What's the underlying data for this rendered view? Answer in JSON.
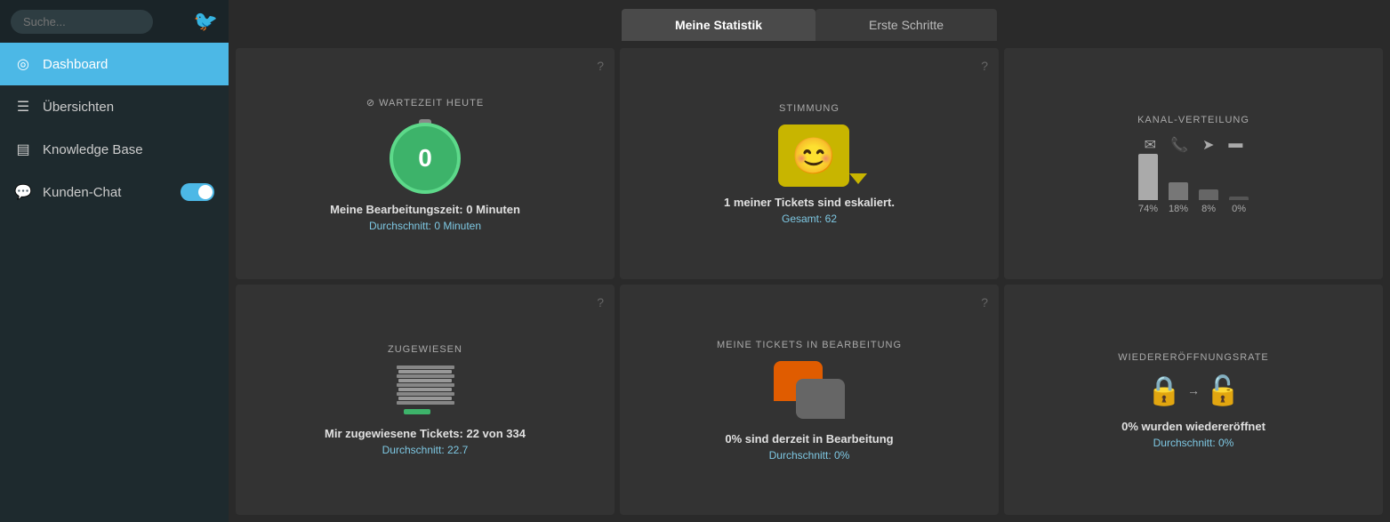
{
  "sidebar": {
    "search_placeholder": "Suche...",
    "items": [
      {
        "id": "dashboard",
        "label": "Dashboard",
        "icon": "⊙",
        "active": true
      },
      {
        "id": "ubersichten",
        "label": "Übersichten",
        "icon": "≡"
      },
      {
        "id": "knowledge-base",
        "label": "Knowledge Base",
        "icon": "▤"
      },
      {
        "id": "kunden-chat",
        "label": "Kunden-Chat",
        "icon": "💬",
        "toggle": true,
        "toggleOn": false
      }
    ]
  },
  "tabs": [
    {
      "id": "meine-statistik",
      "label": "Meine Statistik",
      "active": true
    },
    {
      "id": "erste-schritte",
      "label": "Erste Schritte",
      "active": false
    }
  ],
  "cards": {
    "wartezeit": {
      "title": "⊘ WARTEZEIT HEUTE",
      "value": "0",
      "value_label": "Meine Bearbeitungszeit: 0 Minuten",
      "avg": "Durchschnitt: 0 Minuten"
    },
    "stimmung": {
      "title": "STIMMUNG",
      "line1": "1 meiner Tickets sind eskaliert.",
      "line2": "Gesamt: 62"
    },
    "kanal": {
      "title": "KANAL-VERTEILUNG",
      "bars": [
        {
          "label": "74%",
          "height": "tall"
        },
        {
          "label": "18%",
          "height": "med"
        },
        {
          "label": "8%",
          "height": "small"
        },
        {
          "label": "0%",
          "height": "tiny"
        }
      ]
    },
    "zugewiesen": {
      "title": "ZUGEWIESEN",
      "value_label": "Mir zugewiesene Tickets: 22 von 334",
      "avg": "Durchschnitt: 22.7"
    },
    "bearbeitung": {
      "title": "MEINE TICKETS IN BEARBEITUNG",
      "value_label": "0% sind derzeit in Bearbeitung",
      "avg": "Durchschnitt: 0%"
    },
    "wiederoeffnung": {
      "title": "WIEDERERÖFFNUNGSRATE",
      "value_label": "0% wurden wiedereröffnet",
      "avg": "Durchschnitt: 0%"
    }
  }
}
